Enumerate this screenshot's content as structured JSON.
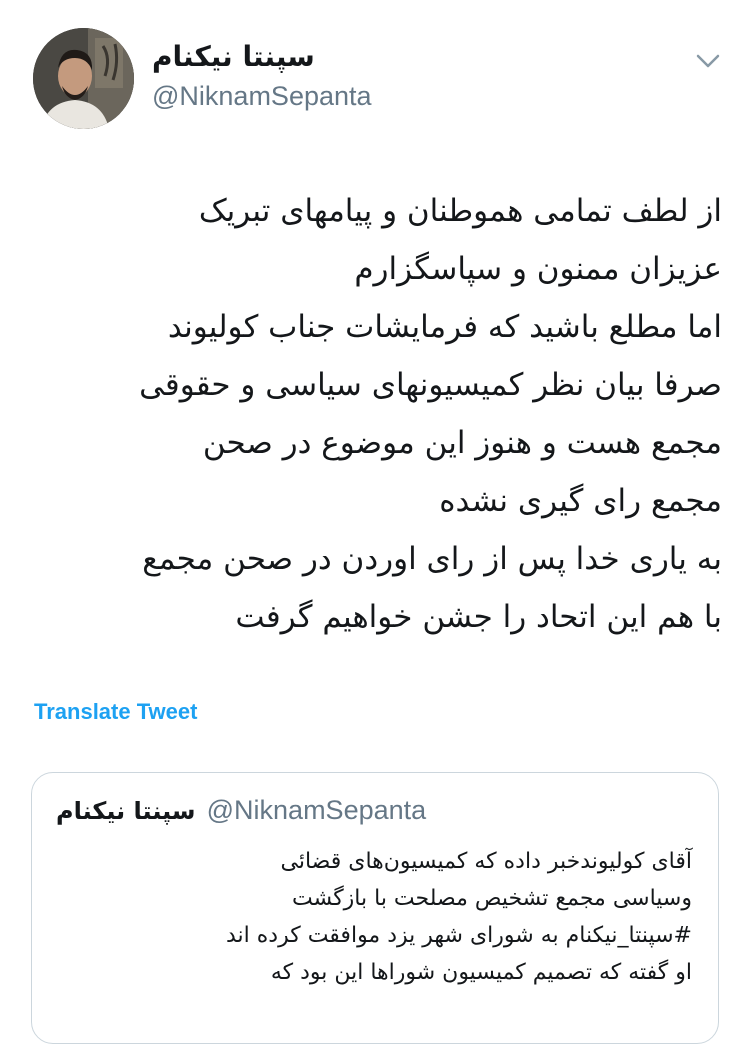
{
  "tweet": {
    "author": {
      "display_name": "سپنتا نیکنام",
      "handle": "@NiknamSepanta"
    },
    "text_lines": [
      "از لطف تمامی هموطنان و پیامهای تبریک",
      "عزیزان ممنون و سپاسگزارم",
      "اما مطلع باشید که فرمایشات جناب کولیوند",
      "صرفا بیان نظر کمیسیونهای سیاسی و حقوقی",
      "مجمع هست و هنوز این موضوع در صحن",
      "مجمع رای گیری نشده",
      "به یاری خدا پس از رای اوردن در صحن مجمع",
      "با هم این اتحاد را جشن خواهیم گرفت"
    ],
    "translate_label": "Translate Tweet",
    "menu_icon": "chevron-down-icon"
  },
  "quoted_tweet": {
    "author": {
      "display_name": "سپنتا نیکنام",
      "handle": "@NiknamSepanta"
    },
    "text_lines": [
      "آقای کولیوندخبر داده که کمیسیون‌های قضائی",
      "وسیاسی مجمع تشخیص مصلحت با بازگشت",
      "#سپنتا_نیکنام به شورای شهر یزد موافقت کرده اند",
      "او گفته که تصمیم کمیسیون شوراها این بود که"
    ]
  },
  "colors": {
    "link": "#1da1f2",
    "secondary_text": "#657786",
    "border": "#ccd6dd"
  }
}
